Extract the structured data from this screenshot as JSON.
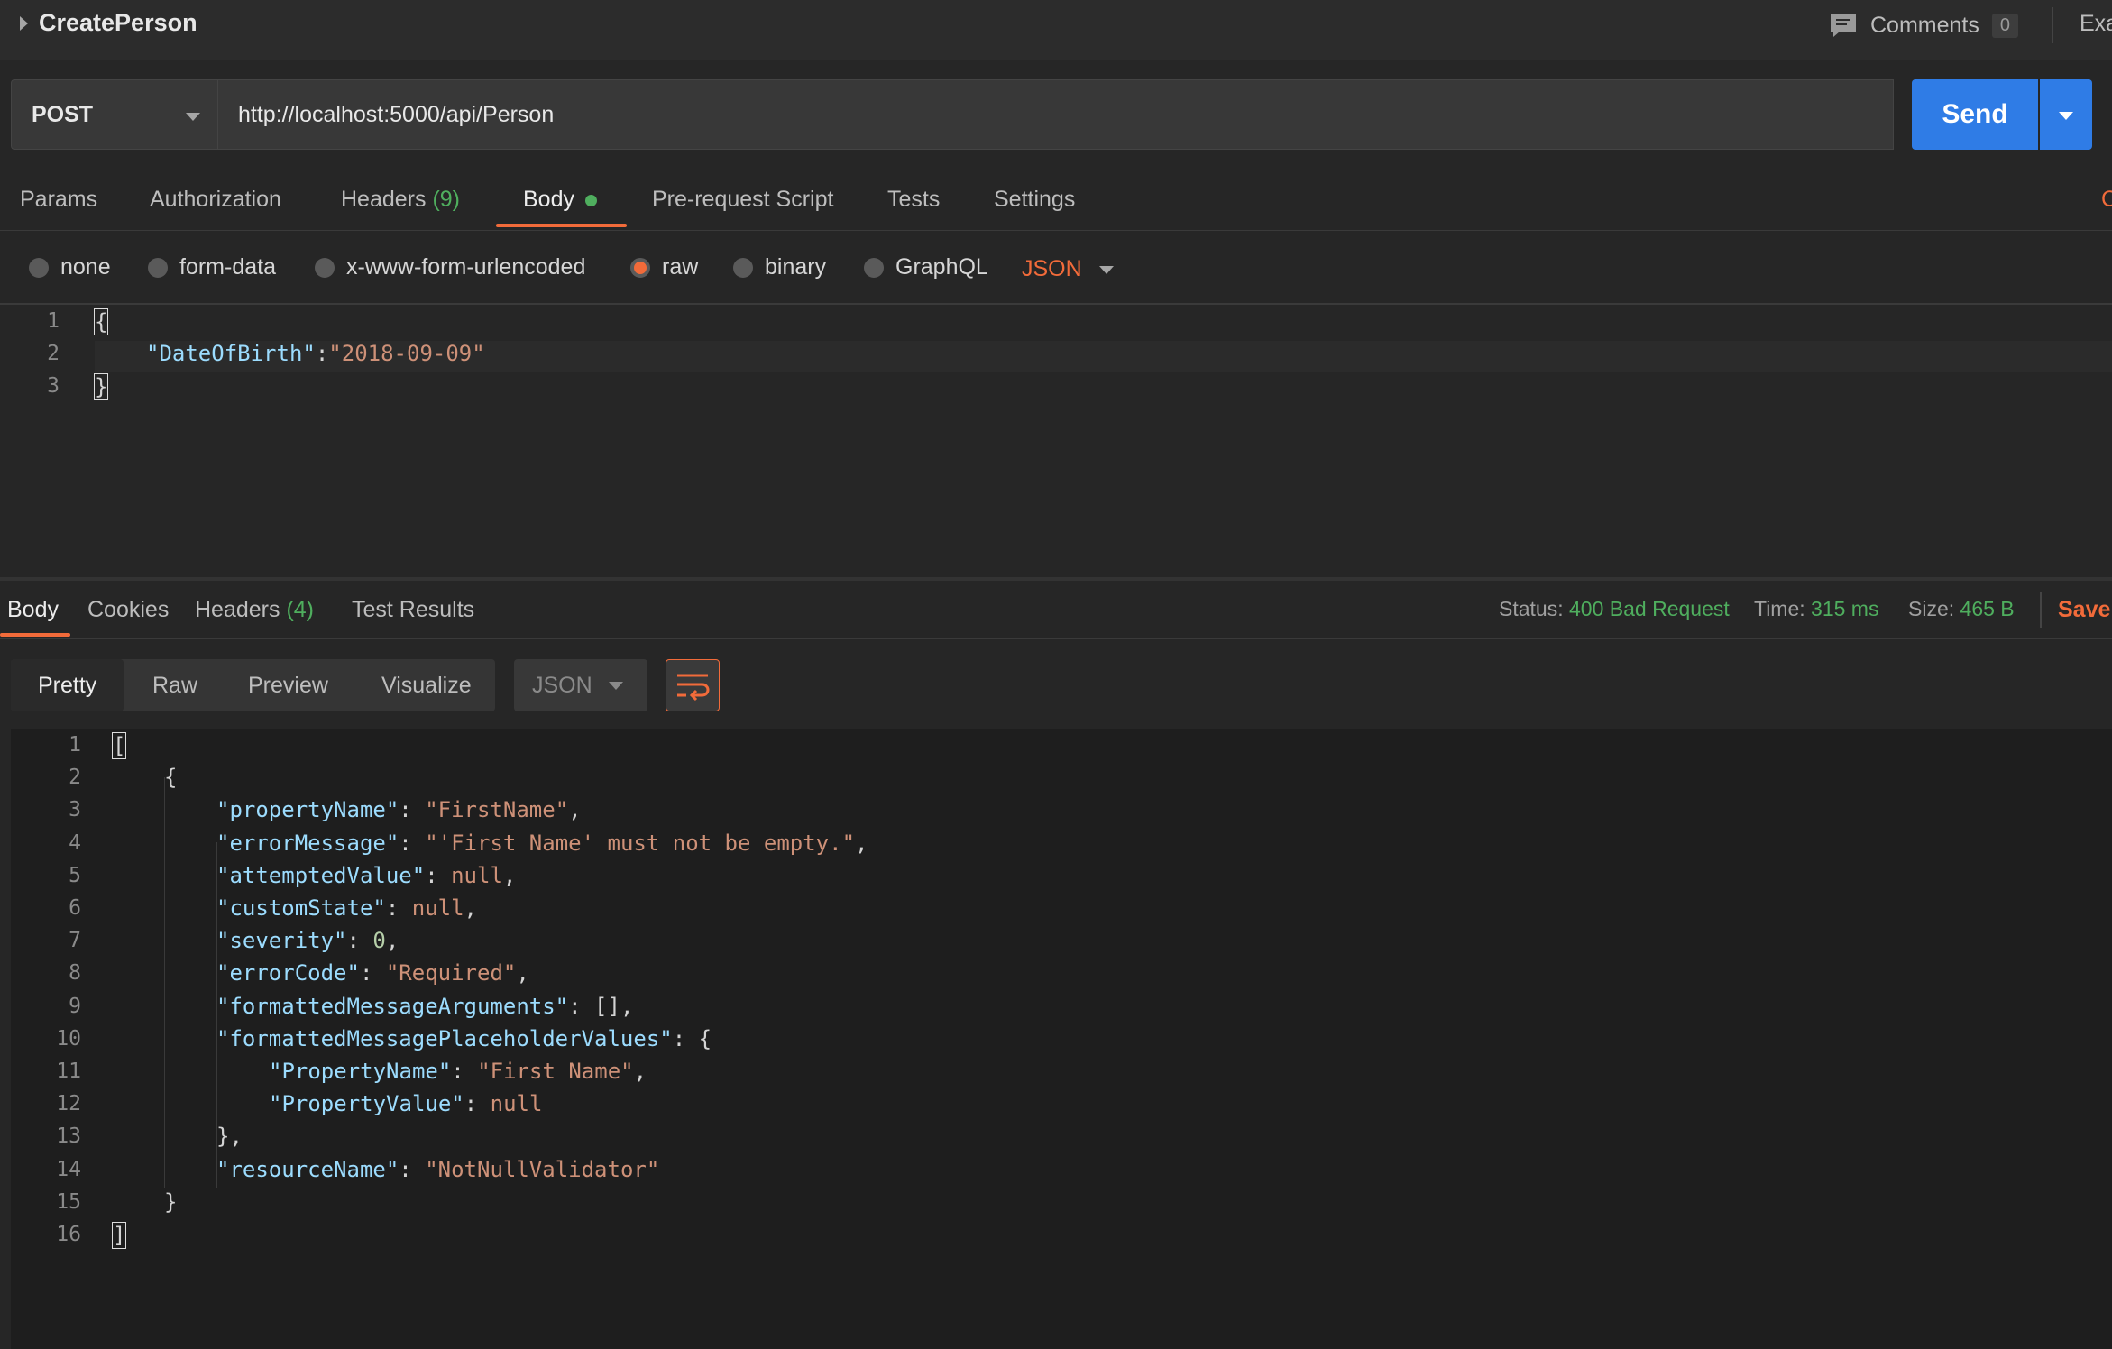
{
  "request": {
    "title": "CreatePerson",
    "comments_label": "Comments",
    "comments_count": "0",
    "examples_label": "Exa",
    "method": "POST",
    "url": "http://localhost:5000/api/Person",
    "send_label": "Send"
  },
  "request_tabs": {
    "params": "Params",
    "authorization": "Authorization",
    "headers": "Headers",
    "headers_count": "(9)",
    "body": "Body",
    "prerequest": "Pre-request Script",
    "tests": "Tests",
    "settings": "Settings"
  },
  "body_types": {
    "none": "none",
    "form_data": "form-data",
    "urlencoded": "x-www-form-urlencoded",
    "raw": "raw",
    "binary": "binary",
    "graphql": "GraphQL",
    "selected": "raw",
    "format": "JSON"
  },
  "request_body": {
    "line_numbers": [
      "1",
      "2",
      "3"
    ],
    "open": "{",
    "key": "\"DateOfBirth\"",
    "colon": ":",
    "value": "\"2018-09-09\"",
    "close": "}"
  },
  "response_tabs": {
    "body": "Body",
    "cookies": "Cookies",
    "headers": "Headers",
    "headers_count": "(4)",
    "test_results": "Test Results"
  },
  "response_status": {
    "status_label": "Status:",
    "status_value": "400 Bad Request",
    "time_label": "Time:",
    "time_value": "315 ms",
    "size_label": "Size:",
    "size_value": "465 B",
    "save_label": "Save"
  },
  "response_view": {
    "pretty": "Pretty",
    "raw": "Raw",
    "preview": "Preview",
    "visualize": "Visualize",
    "format": "JSON"
  },
  "response_body": {
    "line_numbers": [
      "1",
      "2",
      "3",
      "4",
      "5",
      "6",
      "7",
      "8",
      "9",
      "10",
      "11",
      "12",
      "13",
      "14",
      "15",
      "16"
    ],
    "lines": {
      "l1": "[",
      "l2": "{",
      "l3_k": "\"propertyName\"",
      "l3_v": "\"FirstName\"",
      "l4_k": "\"errorMessage\"",
      "l4_v": "\"'First Name' must not be empty.\"",
      "l5_k": "\"attemptedValue\"",
      "l5_v": "null",
      "l6_k": "\"customState\"",
      "l6_v": "null",
      "l7_k": "\"severity\"",
      "l7_v": "0",
      "l8_k": "\"errorCode\"",
      "l8_v": "\"Required\"",
      "l9_k": "\"formattedMessageArguments\"",
      "l9_v": "[]",
      "l10_k": "\"formattedMessagePlaceholderValues\"",
      "l10_v": "{",
      "l11_k": "\"PropertyName\"",
      "l11_v": "\"First Name\"",
      "l12_k": "\"PropertyValue\"",
      "l12_v": "null",
      "l13": "},",
      "l14_k": "\"resourceName\"",
      "l14_v": "\"NotNullValidator\"",
      "l15": "}",
      "l16": "]"
    }
  },
  "colors": {
    "accent": "#f26b3a",
    "send": "#2f7ce6",
    "success": "#4fae5e"
  }
}
